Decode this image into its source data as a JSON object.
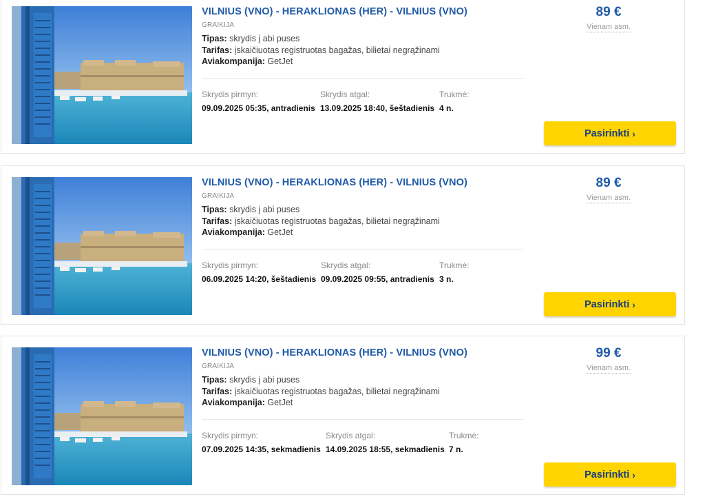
{
  "offers": [
    {
      "route": "VILNIUS (VNO) - HERAKLIONAS (HER) - VILNIUS (VNO)",
      "country": "GRAIKIJA",
      "type_label": "Tipas:",
      "type_value": "skrydis į abi puses",
      "fare_label": "Tarifas:",
      "fare_value": "įskaičiuotas registruotas bagažas, bilietai negrąžinami",
      "airline_label": "Aviakompanija:",
      "airline_value": "GetJet",
      "outbound_label": "Skrydis pirmyn:",
      "outbound_value": "09.09.2025 05:35, antradienis",
      "return_label": "Skrydis atgal:",
      "return_value": "13.09.2025 18:40, šeštadienis",
      "duration_label": "Trukmė:",
      "duration_value": "4 n.",
      "price": "89 €",
      "price_note": "Vienam asm.",
      "select_label": "Pasirinkti"
    },
    {
      "route": "VILNIUS (VNO) - HERAKLIONAS (HER) - VILNIUS (VNO)",
      "country": "GRAIKIJA",
      "type_label": "Tipas:",
      "type_value": "skrydis į abi puses",
      "fare_label": "Tarifas:",
      "fare_value": "įskaičiuotas registruotas bagažas, bilietai negrąžinami",
      "airline_label": "Aviakompanija:",
      "airline_value": "GetJet",
      "outbound_label": "Skrydis pirmyn:",
      "outbound_value": "06.09.2025 14:20, šeštadienis",
      "return_label": "Skrydis atgal:",
      "return_value": "09.09.2025 09:55, antradienis",
      "duration_label": "Trukmė:",
      "duration_value": "3 n.",
      "price": "89 €",
      "price_note": "Vienam asm.",
      "select_label": "Pasirinkti"
    },
    {
      "route": "VILNIUS (VNO) - HERAKLIONAS (HER) - VILNIUS (VNO)",
      "country": "GRAIKIJA",
      "type_label": "Tipas:",
      "type_value": "skrydis į abi puses",
      "fare_label": "Tarifas:",
      "fare_value": "įskaičiuotas registruotas bagažas, bilietai negrąžinami",
      "airline_label": "Aviakompanija:",
      "airline_value": "GetJet",
      "outbound_label": "Skrydis pirmyn:",
      "outbound_value": "07.09.2025 14:35, sekmadienis",
      "return_label": "Skrydis atgal:",
      "return_value": "14.09.2025 18:55, sekmadienis",
      "duration_label": "Trukmė:",
      "duration_value": "7 n.",
      "price": "99 €",
      "price_note": "Vienam asm.",
      "select_label": "Pasirinkti"
    }
  ],
  "icons": {
    "select_chevron": "chevron-right-icon"
  },
  "colors": {
    "route_link": "#1f5aa8",
    "price": "#1f5aa8",
    "button_bg": "#ffd400",
    "button_text": "#1a3f7a"
  }
}
